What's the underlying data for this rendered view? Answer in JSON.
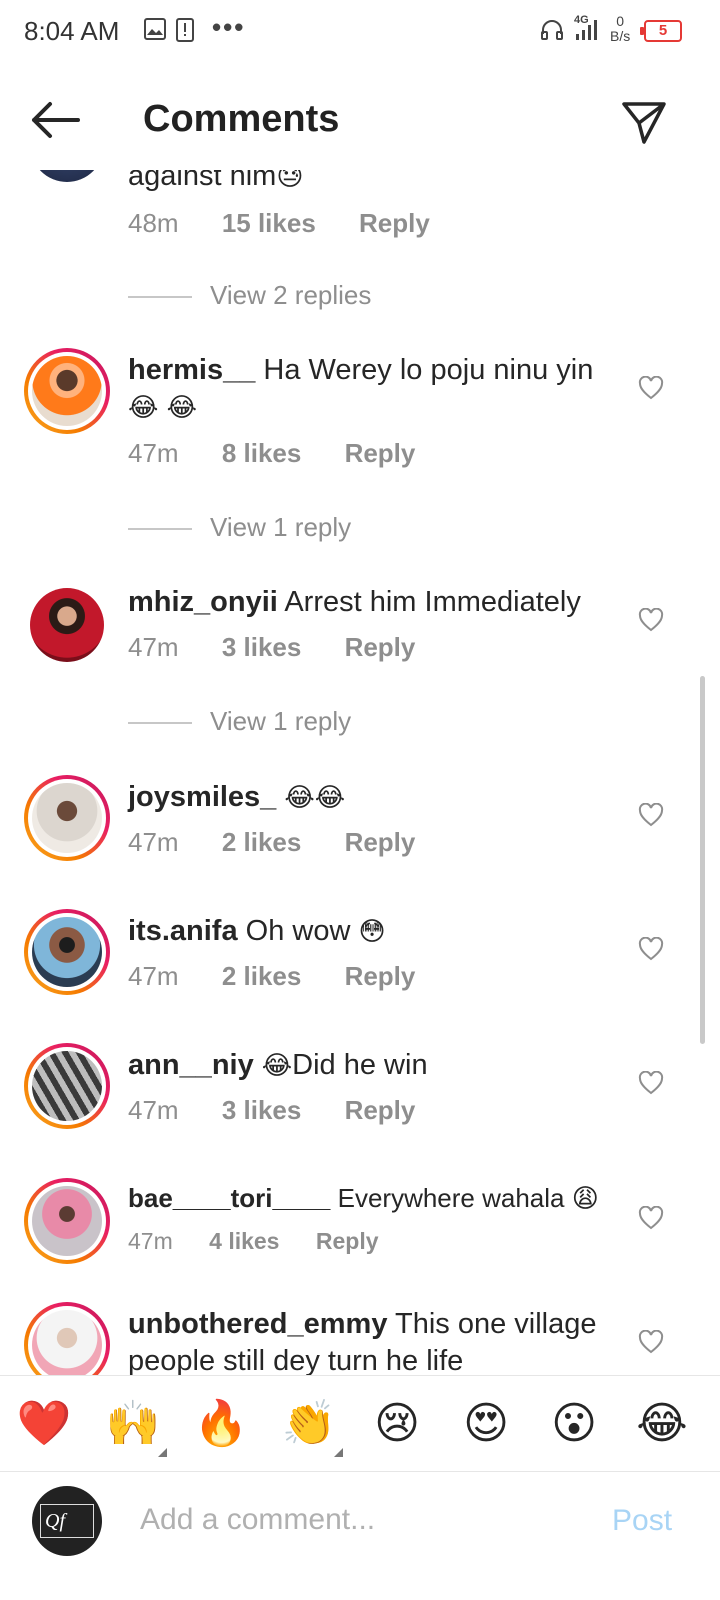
{
  "status_bar": {
    "time": "8:04 AM",
    "dots": "•••",
    "network_type": "4G",
    "speed_value": "0",
    "speed_unit": "B/s",
    "battery": "5"
  },
  "header": {
    "title": "Comments",
    "back_icon": "arrow-left-icon",
    "share_icon": "paper-plane-icon"
  },
  "comments": [
    {
      "username": "",
      "text": "against him",
      "emoji": "😓",
      "time": "48m",
      "likes": "15 likes",
      "reply": "Reply",
      "view_replies": "View 2 replies"
    },
    {
      "username": "hermis__",
      "text": "Ha Werey lo poju ninu yin",
      "emoji": "😂 😂",
      "time": "47m",
      "likes": "8 likes",
      "reply": "Reply",
      "view_replies": "View 1 reply"
    },
    {
      "username": "mhiz_onyii",
      "text": "Arrest him Immediately",
      "time": "47m",
      "likes": "3 likes",
      "reply": "Reply",
      "view_replies": "View 1 reply"
    },
    {
      "username": "joysmiles_",
      "emoji": "😂😂",
      "time": "47m",
      "likes": "2 likes",
      "reply": "Reply"
    },
    {
      "username": "its.anifa",
      "text": "Oh wow",
      "emoji": "😳",
      "time": "47m",
      "likes": "2 likes",
      "reply": "Reply"
    },
    {
      "username": "ann__niy",
      "emoji": "😂",
      "text": "Did he win",
      "time": "47m",
      "likes": "3 likes",
      "reply": "Reply"
    },
    {
      "username": "bae____tori____",
      "text": "Everywhere wahala",
      "emoji": "😩",
      "time": "47m",
      "likes": "4 likes",
      "reply": "Reply"
    },
    {
      "username": "unbothered_emmy",
      "text": "This one village people still dey turn he life"
    }
  ],
  "emoji_bar": [
    "❤️",
    "🙌",
    "🔥",
    "👏",
    "😢",
    "😍",
    "😮",
    "😂"
  ],
  "composer": {
    "avatar_logo": "Qf",
    "placeholder": "Add a comment...",
    "post_label": "Post"
  },
  "colors": {
    "text": "#262626",
    "muted": "#8e8e8e",
    "story_ring_start": "#f9a825",
    "story_ring_end": "#c2185b",
    "post_disabled": "#a8d4f5",
    "battery_low": "#e53935"
  }
}
